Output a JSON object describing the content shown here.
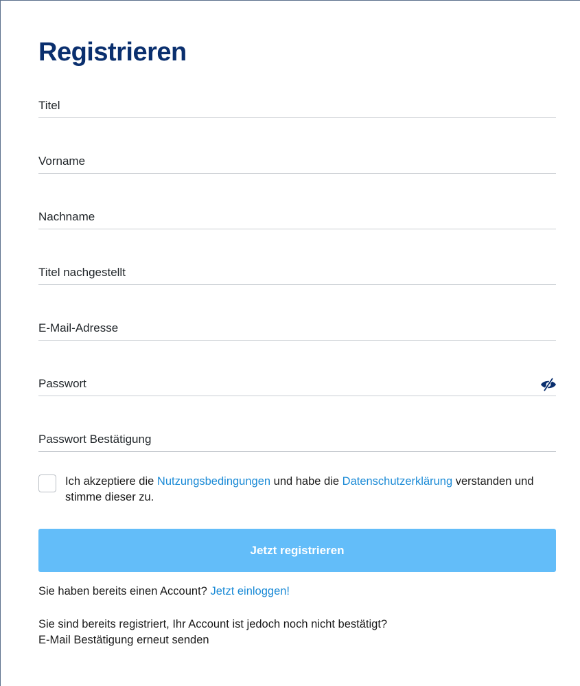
{
  "page": {
    "title": "Registrieren"
  },
  "fields": [
    {
      "name": "title-field",
      "placeholder": "Titel",
      "type": "text"
    },
    {
      "name": "first-name-field",
      "placeholder": "Vorname",
      "type": "text"
    },
    {
      "name": "last-name-field",
      "placeholder": "Nachname",
      "type": "text"
    },
    {
      "name": "title-suffix-field",
      "placeholder": "Titel nachgestellt",
      "type": "text"
    },
    {
      "name": "email-field",
      "placeholder": "E-Mail-Adresse",
      "type": "email"
    },
    {
      "name": "password-field",
      "placeholder": "Passwort",
      "type": "password"
    },
    {
      "name": "password-confirm-field",
      "placeholder": "Passwort Bestätigung",
      "type": "password"
    }
  ],
  "password_toggle": {
    "icon": "eye-slash-icon"
  },
  "consent": {
    "checked": false,
    "text_1": "Ich akzeptiere die ",
    "terms_link": "Nutzungsbedingungen",
    "text_2": " und habe die ",
    "privacy_link": "Datenschutzerklärung",
    "text_3": " verstanden und stimme dieser zu."
  },
  "submit": {
    "label": "Jetzt registrieren"
  },
  "login": {
    "text": "Sie haben bereits einen Account? ",
    "link": "Jetzt einloggen!"
  },
  "confirm": {
    "text": "Sie sind bereits registriert, Ihr Account ist jedoch noch nicht bestätigt?",
    "link": "E-Mail Bestätigung erneut senden"
  },
  "colors": {
    "title": "#0a2f6e",
    "link": "#1a8ad6",
    "button": "#63bdf9",
    "border": "#c9cdd2"
  }
}
